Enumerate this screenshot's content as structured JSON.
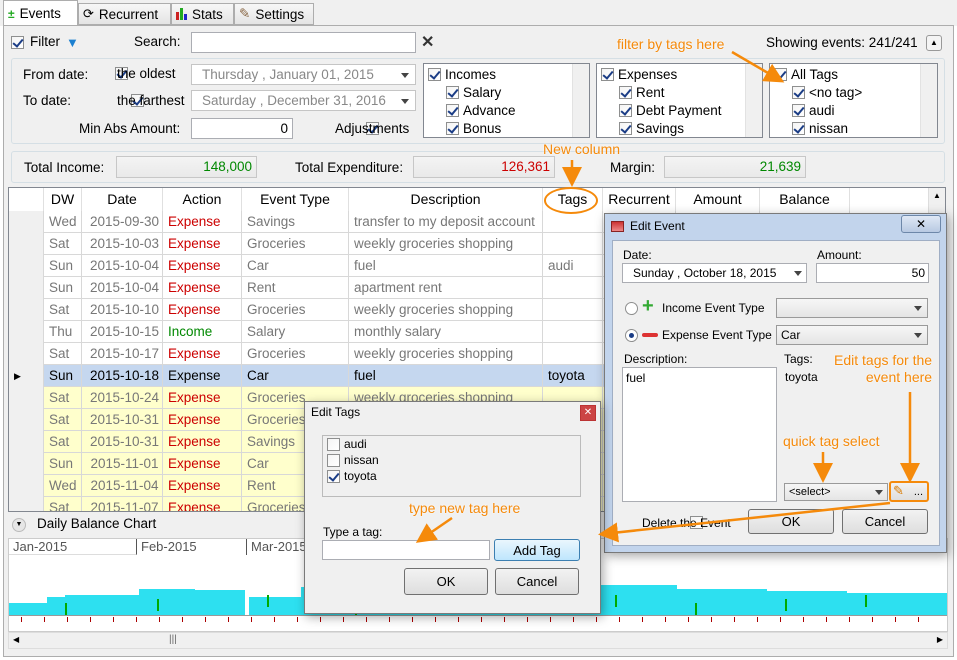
{
  "tabs": [
    {
      "label": "Events",
      "icon": "events-icon"
    },
    {
      "label": "Recurrent",
      "icon": "recurrent-icon"
    },
    {
      "label": "Stats",
      "icon": "stats-icon"
    },
    {
      "label": "Settings",
      "icon": "settings-icon"
    }
  ],
  "filter": {
    "label": "Filter",
    "search_label": "Search:",
    "search_value": "",
    "showing": "Showing events: 241/241",
    "from_label": "From date:",
    "from_oldest": "the oldest",
    "from_value": "Thursday  ,   January   01, 2015",
    "to_label": "To date:",
    "to_farthest": "the farthest",
    "to_value": "Saturday  , December 31, 2016",
    "min_label": "Min Abs Amount:",
    "min_value": "0",
    "adjustments": "Adjustments",
    "incomes": [
      "Incomes",
      "Salary",
      "Advance",
      "Bonus"
    ],
    "expenses": [
      "Expenses",
      "Rent",
      "Debt Payment",
      "Savings"
    ],
    "tags": [
      "All Tags",
      "<no tag>",
      "audi",
      "nissan"
    ]
  },
  "totals": {
    "income_label": "Total Income:",
    "income": "148,000",
    "expenditure_label": "Total Expenditure:",
    "expenditure": "126,361",
    "margin_label": "Margin:",
    "margin": "21,639"
  },
  "grid": {
    "headers": [
      "DW",
      "Date",
      "Action",
      "Event Type",
      "Description",
      "Tags",
      "Recurrent",
      "Amount",
      "Balance"
    ],
    "rows": [
      [
        "Wed",
        "2015-09-30",
        "Expense",
        "Savings",
        "transfer to my deposit account",
        ""
      ],
      [
        "Sat",
        "2015-10-03",
        "Expense",
        "Groceries",
        "weekly groceries shopping",
        ""
      ],
      [
        "Sun",
        "2015-10-04",
        "Expense",
        "Car",
        "fuel",
        "audi"
      ],
      [
        "Sun",
        "2015-10-04",
        "Expense",
        "Rent",
        "apartment rent",
        ""
      ],
      [
        "Sat",
        "2015-10-10",
        "Expense",
        "Groceries",
        "weekly groceries shopping",
        ""
      ],
      [
        "Thu",
        "2015-10-15",
        "Income",
        "Salary",
        "monthly salary",
        ""
      ],
      [
        "Sat",
        "2015-10-17",
        "Expense",
        "Groceries",
        "weekly groceries shopping",
        ""
      ],
      [
        "Sun",
        "2015-10-18",
        "Expense",
        "Car",
        "fuel",
        "toyota"
      ],
      [
        "Sat",
        "2015-10-24",
        "Expense",
        "Groceries",
        "weekly groceries shopping",
        ""
      ],
      [
        "Sat",
        "2015-10-31",
        "Expense",
        "Groceries",
        "",
        ""
      ],
      [
        "Sat",
        "2015-10-31",
        "Expense",
        "Savings",
        "",
        ""
      ],
      [
        "Sun",
        "2015-11-01",
        "Expense",
        "Car",
        "",
        ""
      ],
      [
        "Wed",
        "2015-11-04",
        "Expense",
        "Rent",
        "",
        ""
      ],
      [
        "Sat",
        "2015-11-07",
        "Expense",
        "Groceries",
        "",
        ""
      ]
    ]
  },
  "chart": {
    "title": "Daily Balance Chart",
    "months": [
      "Jan-2015",
      "Feb-2015",
      "Mar-2015"
    ]
  },
  "edit_event": {
    "title": "Edit Event",
    "date_label": "Date:",
    "date_value": "Sunday    ,   October   18, 2015",
    "amount_label": "Amount:",
    "amount": "50",
    "income_type": "Income Event Type",
    "expense_type": "Expense Event Type",
    "expense_value": "Car",
    "desc_label": "Description:",
    "desc": "fuel",
    "tags_label": "Tags:",
    "tags": "toyota",
    "select": "<select>",
    "dots": "...",
    "delete": "Delete the Event",
    "ok": "OK",
    "cancel": "Cancel"
  },
  "edit_tags": {
    "title": "Edit Tags",
    "tags": [
      {
        "name": "audi",
        "checked": false
      },
      {
        "name": "nissan",
        "checked": false
      },
      {
        "name": "toyota",
        "checked": true
      }
    ],
    "type_label": "Type a tag:",
    "add": "Add Tag",
    "ok": "OK",
    "cancel": "Cancel"
  },
  "annotations": {
    "filter_tags": "filter by tags here",
    "new_column": "New column",
    "edit_tags": "Edit tags for the\nevent here",
    "quick": "quick tag select",
    "type_new": "type new tag here"
  },
  "colors": {
    "annotation": "#f58a0b",
    "expense": "#cc0000",
    "income": "#008800",
    "chart_bar": "#2de0f0",
    "selected_row": "#c5d7ef",
    "highlight_row": "#ffffcc"
  }
}
